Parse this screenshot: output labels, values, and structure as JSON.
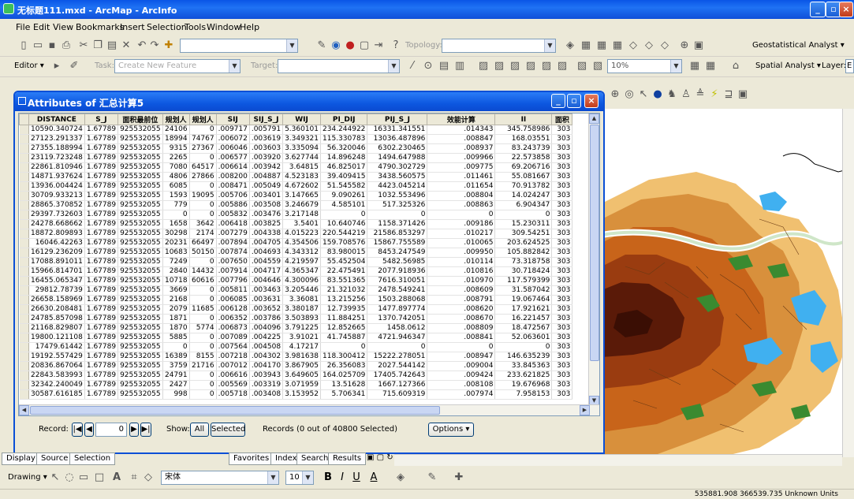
{
  "app": {
    "title": "无标题111.mxd - ArcMap - ArcInfo"
  },
  "menu": [
    "File",
    "Edit",
    "View",
    "Bookmarks",
    "Insert",
    "Selection",
    "Tools",
    "Window",
    "Help"
  ],
  "toolbar": {
    "topology_label": "Topology:",
    "geostat_label": "Geostatistical Analyst ▾",
    "editor_label": "Editor ▾",
    "task_label": "Task:",
    "task_value": "Create New Feature",
    "target_label": "Target:",
    "zoom_value": "10%",
    "spatial_label": "Spatial Analyst ▾",
    "layer_label": "Layer:",
    "layer_value": "E"
  },
  "attributes": {
    "title": "Attributes of 汇总计算5",
    "columns": [
      "DISTANCE",
      "S_J",
      "面积最前位",
      "规划人",
      "规划人",
      "SIJ",
      "SIJ_S_J",
      "WIJ",
      "PI_DIJ",
      "PIJ_S_J",
      "效能计算",
      "II",
      "面积"
    ],
    "rows": [
      [
        "10590.340724",
        "1.67789",
        "925532055",
        "24106",
        "0",
        ".009717",
        ".005791",
        "5.360101",
        "234.244922",
        "16331.341551",
        ".014343",
        "345.758986",
        "303"
      ],
      [
        "27123.291337",
        "1.67789",
        "925532055",
        "18994",
        "74767",
        ".006072",
        ".003619",
        "3.349321",
        "115.330783",
        "13036.487896",
        ".008847",
        "168.03551",
        "303"
      ],
      [
        "27355.188994",
        "1.67789",
        "925532055",
        "9315",
        "27367",
        ".006046",
        ".003603",
        "3.335094",
        "56.320046",
        "6302.230465",
        ".008937",
        "83.243739",
        "303"
      ],
      [
        "23119.723248",
        "1.67789",
        "925532055",
        "2265",
        "0",
        ".006577",
        ".003920",
        "3.627744",
        "14.896248",
        "1494.647988",
        ".009966",
        "22.573858",
        "303"
      ],
      [
        "22861.810946",
        "1.67789",
        "925532055",
        "7080",
        "64517",
        ".006614",
        ".003942",
        "3.64815",
        "46.825017",
        "4790.302729",
        ".009775",
        "69.206716",
        "303"
      ],
      [
        "14871.937624",
        "1.67789",
        "925532055",
        "4806",
        "27866",
        ".008200",
        ".004887",
        "4.523183",
        "39.409415",
        "3438.560575",
        ".011461",
        "55.081667",
        "303"
      ],
      [
        "13936.004424",
        "1.67789",
        "925532055",
        "6085",
        "0",
        ".008471",
        ".005049",
        "4.672602",
        "51.545582",
        "4423.045214",
        ".011654",
        "70.913782",
        "303"
      ],
      [
        "30709.933213",
        "1.67789",
        "925532055",
        "1593",
        "19095",
        ".005706",
        ".003401",
        "3.147665",
        "9.090261",
        "1032.553496",
        ".008804",
        "14.024247",
        "303"
      ],
      [
        "28865.370852",
        "1.67789",
        "925532055",
        "779",
        "0",
        ".005886",
        ".003508",
        "3.246679",
        "4.585101",
        "517.325326",
        ".008863",
        "6.904347",
        "303"
      ],
      [
        "29397.732603",
        "1.67789",
        "925532055",
        "0",
        "0",
        ".005832",
        ".003476",
        "3.217148",
        "0",
        "0",
        "0",
        "0",
        "303"
      ],
      [
        "24278.668662",
        "1.67789",
        "925532055",
        "1658",
        "3642",
        ".006418",
        ".003825",
        "3.5401",
        "10.640746",
        "1158.371426",
        ".009186",
        "15.230311",
        "303"
      ],
      [
        "18872.809893",
        "1.67789",
        "925532055",
        "30298",
        "2174",
        ".007279",
        ".004338",
        "4.015223",
        "220.544219",
        "21586.853297",
        ".010217",
        "309.54251",
        "303"
      ],
      [
        "16046.42263",
        "1.67789",
        "925532055",
        "20231",
        "66497",
        ".007894",
        ".004705",
        "4.354506",
        "159.708576",
        "15867.755589",
        ".010065",
        "203.624525",
        "303"
      ],
      [
        "16129.236209",
        "1.67789",
        "925532055",
        "10683",
        "50150",
        ".007874",
        ".004693",
        "4.343312",
        "83.980015",
        "8453.247549",
        ".009950",
        "105.882842",
        "303"
      ],
      [
        "17088.891011",
        "1.67789",
        "925532055",
        "7249",
        "0",
        ".007650",
        ".004559",
        "4.219597",
        "55.452504",
        "5482.56985",
        ".010114",
        "73.318758",
        "303"
      ],
      [
        "15966.814701",
        "1.67789",
        "925532055",
        "2840",
        "14432",
        ".007914",
        ".004717",
        "4.365347",
        "22.475491",
        "2077.918936",
        ".010816",
        "30.718424",
        "303"
      ],
      [
        "16455.065347",
        "1.67789",
        "925532055",
        "10718",
        "60616",
        ".007796",
        ".004646",
        "4.300096",
        "83.551365",
        "7616.310051",
        ".010970",
        "117.579399",
        "303"
      ],
      [
        "29812.78739",
        "1.67789",
        "925532055",
        "3669",
        "0",
        ".005811",
        ".003463",
        "3.205446",
        "21.321032",
        "2478.549241",
        ".008609",
        "31.587042",
        "303"
      ],
      [
        "26658.158969",
        "1.67789",
        "925532055",
        "2168",
        "0",
        ".006085",
        ".003631",
        "3.36081",
        "13.215256",
        "1503.288068",
        ".008791",
        "19.067464",
        "303"
      ],
      [
        "26630.208481",
        "1.67789",
        "925532055",
        "2079",
        "11685",
        ".006128",
        ".003652",
        "3.380187",
        "12.739935",
        "1477.897774",
        ".008620",
        "17.921621",
        "303"
      ],
      [
        "24785.857098",
        "1.67789",
        "925532055",
        "1871",
        "0",
        ".006352",
        ".003786",
        "3.503893",
        "11.884251",
        "1370.742051",
        ".008670",
        "16.221457",
        "303"
      ],
      [
        "21168.829807",
        "1.67789",
        "925532055",
        "1870",
        "5774",
        ".006873",
        ".004096",
        "3.791225",
        "12.852665",
        "1458.0612",
        ".008809",
        "18.472567",
        "303"
      ],
      [
        "19800.121108",
        "1.67789",
        "925532055",
        "5885",
        "0",
        ".007089",
        ".004225",
        "3.91021",
        "41.745887",
        "4721.946347",
        ".008841",
        "52.063601",
        "303"
      ],
      [
        "17479.61442",
        "1.67789",
        "925532055",
        "0",
        "0",
        ".007564",
        ".004508",
        "4.17217",
        "0",
        "0",
        "0",
        "0",
        "303"
      ],
      [
        "19192.557429",
        "1.67789",
        "925532055",
        "16389",
        "8155",
        ".007218",
        ".004302",
        "3.981638",
        "118.300412",
        "15222.278051",
        ".008947",
        "146.635239",
        "303"
      ],
      [
        "20836.867064",
        "1.67789",
        "925532055",
        "3759",
        "21716",
        ".007012",
        ".004170",
        "3.867905",
        "26.356083",
        "2027.544142",
        ".009004",
        "33.845363",
        "303"
      ],
      [
        "22843.583993",
        "1.67789",
        "925532055",
        "24791",
        "0",
        ".006616",
        ".003943",
        "3.649605",
        "164.025709",
        "17405.742643",
        ".009424",
        "233.621825",
        "303"
      ],
      [
        "32342.240049",
        "1.67789",
        "925532055",
        "2427",
        "0",
        ".005569",
        ".003319",
        "3.071959",
        "13.51628",
        "1667.127366",
        ".008108",
        "19.676968",
        "303"
      ],
      [
        "30587.616185",
        "1.67789",
        "925532055",
        "998",
        "0",
        ".005718",
        ".003408",
        "3.153952",
        "5.706341",
        "715.609319",
        ".007974",
        "7.958153",
        "303"
      ]
    ],
    "record_label": "Record:",
    "record_value": "0",
    "show_label": "Show:",
    "all_label": "All",
    "selected_label": "Selected",
    "records_text": "Records (0 out of 40800 Selected)",
    "options_label": "Options ▾"
  },
  "toc_tabs": [
    "Display",
    "Source",
    "Selection"
  ],
  "results_tabs": [
    "Favorites",
    "Index",
    "Search",
    "Results"
  ],
  "drawing": {
    "drawing_label": "Drawing ▾",
    "font_value": "宋体",
    "size_value": "10",
    "bold": "B",
    "italic": "I",
    "underline": "U",
    "font_color": "A"
  },
  "status": {
    "coords": "535881.908  366539.735 Unknown Units"
  },
  "colors": {
    "title_blue": "#0a56e6",
    "map_dark": "#5a1a08",
    "map_mid": "#c8641a",
    "map_light": "#f0c070",
    "water": "#40b0f0",
    "green": "#3a8a30"
  }
}
